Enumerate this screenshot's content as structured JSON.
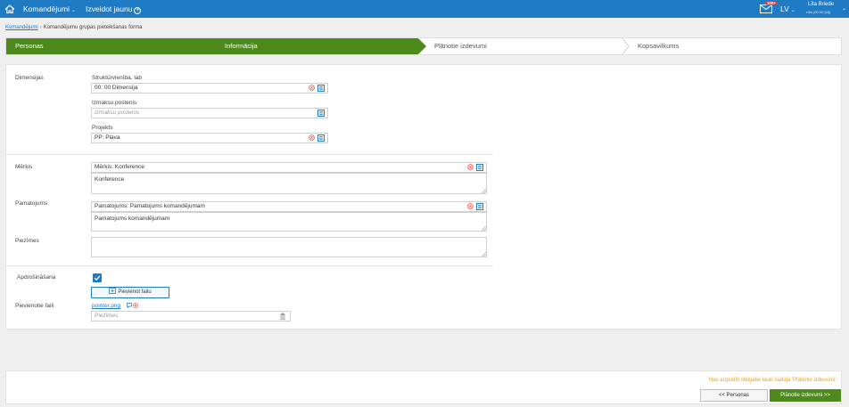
{
  "topbar": {
    "menu_komandejumi": "Komandējumi",
    "menu_izveidot": "Izveidot jaunu",
    "mail_badge": "100+",
    "language": "LV",
    "user_name": "Līta Briede",
    "user_sub": "rūta (00:00 [id])",
    "bg_color": "#1f7bc4"
  },
  "breadcrumb": {
    "link": "Komandējumi",
    "separator": "›",
    "current": "Komandējumu grupas pieteikšanas forma"
  },
  "wizard": {
    "steps": [
      {
        "label": "Personas",
        "state": "done"
      },
      {
        "label": "Informācija",
        "state": "active"
      },
      {
        "label": "Plānotie izdevumi",
        "state": "pending"
      },
      {
        "label": "Kopsavilkums",
        "state": "pending"
      }
    ],
    "active_color": "#4d8a1b"
  },
  "form": {
    "dimensijas": {
      "label": "Dimensijas",
      "struktur_label": "Struktūrvienība, lab",
      "struktur_value": "00: 00 Dimensija",
      "izmaksu_label": "Izmaksu postenis",
      "izmaksu_placeholder": "Izmaksu postenis",
      "projekts_label": "Projekts",
      "projekts_value": "PP: Plava"
    },
    "merkis": {
      "label": "Mērķis",
      "select_value": "Mērķis: Konference",
      "text": "Konference"
    },
    "pamatojums": {
      "label": "Pamatojums",
      "select_value": "Pamatojums: Pamatojums komandējumam",
      "text": "Pamatojums komandējumam"
    },
    "piezimes": {
      "label": "Piezīmes",
      "text": ""
    },
    "apdrosinasana": {
      "label": "Apdrošināšana",
      "checked": true
    },
    "faili": {
      "button_label": "Pievienot failu",
      "label": "Pievienotie faili",
      "file_name": "pointer.png",
      "note_placeholder": "Piezīmes"
    }
  },
  "footer": {
    "warning": "Nav aizpildīti obligātie lauki sadaļā 'Plānotie izdevumi'.",
    "prev_label": "<< Personas",
    "next_label": "Plānotie izdevumi >>",
    "warning_color": "#f39c12"
  }
}
